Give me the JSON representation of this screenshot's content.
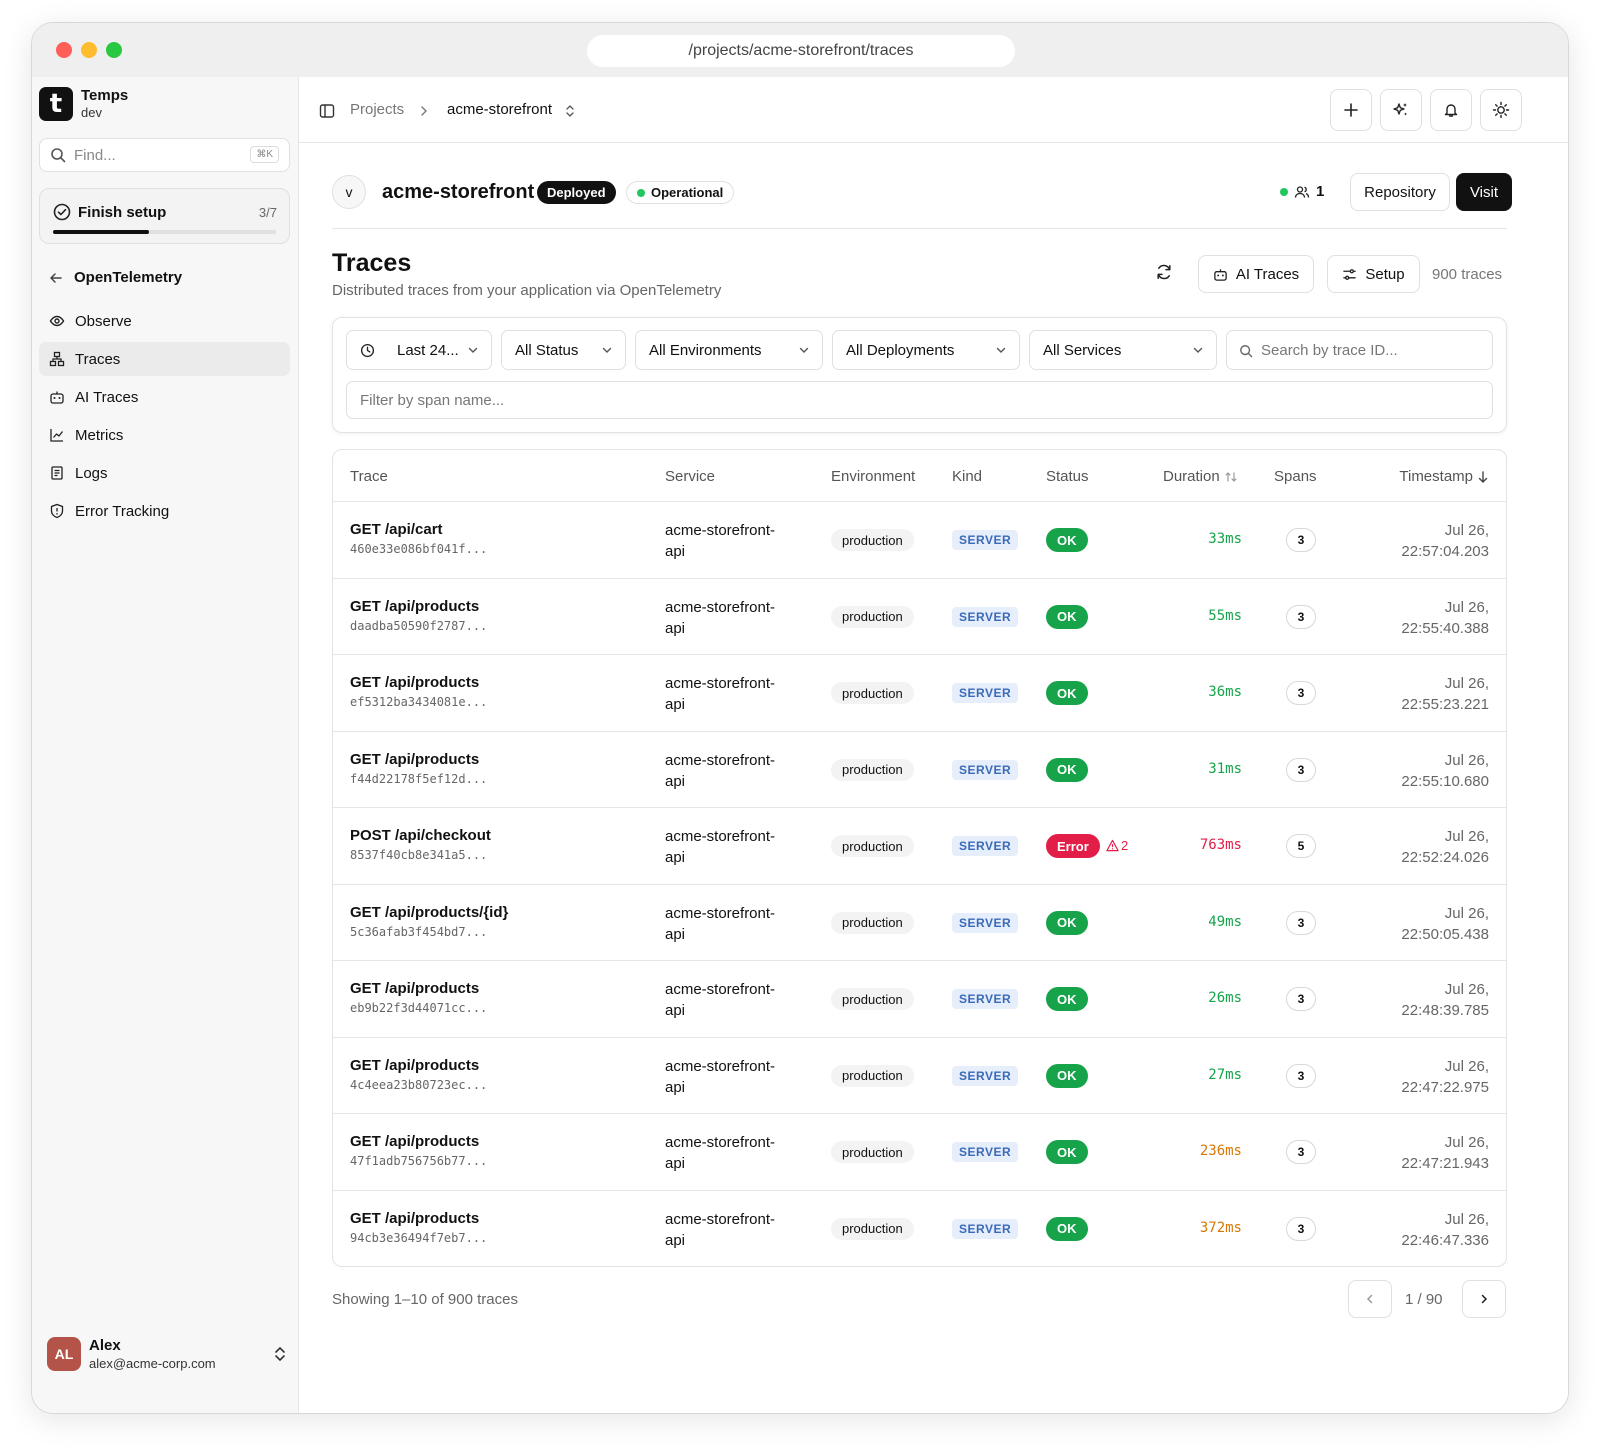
{
  "browser": {
    "url": "/projects/acme-storefront/traces"
  },
  "sidebar": {
    "brand_name": "Temps",
    "brand_env": "dev",
    "logo_letter": "t",
    "find_placeholder": "Find...",
    "find_shortcut": "⌘K",
    "setup_label": "Finish setup",
    "setup_count": "3/7",
    "setup_progress": 0.43,
    "back_label": "OpenTelemetry",
    "items": [
      {
        "label": "Observe",
        "icon": "eye-icon"
      },
      {
        "label": "Traces",
        "icon": "tree-icon",
        "active": true
      },
      {
        "label": "AI Traces",
        "icon": "robot-icon"
      },
      {
        "label": "Metrics",
        "icon": "chart-line-icon"
      },
      {
        "label": "Logs",
        "icon": "scroll-icon"
      },
      {
        "label": "Error Tracking",
        "icon": "shield-alert-icon"
      }
    ],
    "user": {
      "initials": "AL",
      "name": "Alex",
      "email": "alex@acme-corp.com"
    }
  },
  "topbar": {
    "crumb_projects": "Projects",
    "crumb_project": "acme-storefront"
  },
  "project": {
    "avatar": "v",
    "name": "acme-storefront",
    "deployed_label": "Deployed",
    "status_label": "Operational",
    "members_count": "1",
    "repo_label": "Repository",
    "visit_label": "Visit"
  },
  "page": {
    "title": "Traces",
    "subtitle": "Distributed traces from your application via OpenTelemetry",
    "ai_traces_label": "AI Traces",
    "setup_label": "Setup",
    "count_label": "900 traces"
  },
  "filters": {
    "time": "Last 24...",
    "status": "All Status",
    "environments": "All Environments",
    "deployments": "All Deployments",
    "services": "All Services",
    "search_placeholder": "Search by trace ID...",
    "span_placeholder": "Filter by span name..."
  },
  "table": {
    "headers": {
      "trace": "Trace",
      "service": "Service",
      "environment": "Environment",
      "kind": "Kind",
      "status": "Status",
      "duration": "Duration",
      "spans": "Spans",
      "timestamp": "Timestamp"
    },
    "rows": [
      {
        "name": "GET /api/cart",
        "id": "460e33e086bf041f...",
        "service1": "acme-storefront-",
        "service2": "api",
        "env": "production",
        "kind": "SERVER",
        "status": "OK",
        "status_type": "ok",
        "duration": "33ms",
        "dur_color": "#16a34a",
        "spans": "3",
        "date": "Jul 26,",
        "time": "22:57:04.203"
      },
      {
        "name": "GET /api/products",
        "id": "daadba50590f2787...",
        "service1": "acme-storefront-",
        "service2": "api",
        "env": "production",
        "kind": "SERVER",
        "status": "OK",
        "status_type": "ok",
        "duration": "55ms",
        "dur_color": "#16a34a",
        "spans": "3",
        "date": "Jul 26,",
        "time": "22:55:40.388"
      },
      {
        "name": "GET /api/products",
        "id": "ef5312ba3434081e...",
        "service1": "acme-storefront-",
        "service2": "api",
        "env": "production",
        "kind": "SERVER",
        "status": "OK",
        "status_type": "ok",
        "duration": "36ms",
        "dur_color": "#16a34a",
        "spans": "3",
        "date": "Jul 26,",
        "time": "22:55:23.221"
      },
      {
        "name": "GET /api/products",
        "id": "f44d22178f5ef12d...",
        "service1": "acme-storefront-",
        "service2": "api",
        "env": "production",
        "kind": "SERVER",
        "status": "OK",
        "status_type": "ok",
        "duration": "31ms",
        "dur_color": "#16a34a",
        "spans": "3",
        "date": "Jul 26,",
        "time": "22:55:10.680"
      },
      {
        "name": "POST /api/checkout",
        "id": "8537f40cb8e341a5...",
        "service1": "acme-storefront-",
        "service2": "api",
        "env": "production",
        "kind": "SERVER",
        "status": "Error",
        "status_type": "err",
        "warn_count": "2",
        "duration": "763ms",
        "dur_color": "#e11d48",
        "spans": "5",
        "date": "Jul 26,",
        "time": "22:52:24.026"
      },
      {
        "name": "GET /api/products/{id}",
        "id": "5c36afab3f454bd7...",
        "service1": "acme-storefront-",
        "service2": "api",
        "env": "production",
        "kind": "SERVER",
        "status": "OK",
        "status_type": "ok",
        "duration": "49ms",
        "dur_color": "#16a34a",
        "spans": "3",
        "date": "Jul 26,",
        "time": "22:50:05.438"
      },
      {
        "name": "GET /api/products",
        "id": "eb9b22f3d44071cc...",
        "service1": "acme-storefront-",
        "service2": "api",
        "env": "production",
        "kind": "SERVER",
        "status": "OK",
        "status_type": "ok",
        "duration": "26ms",
        "dur_color": "#16a34a",
        "spans": "3",
        "date": "Jul 26,",
        "time": "22:48:39.785"
      },
      {
        "name": "GET /api/products",
        "id": "4c4eea23b80723ec...",
        "service1": "acme-storefront-",
        "service2": "api",
        "env": "production",
        "kind": "SERVER",
        "status": "OK",
        "status_type": "ok",
        "duration": "27ms",
        "dur_color": "#16a34a",
        "spans": "3",
        "date": "Jul 26,",
        "time": "22:47:22.975"
      },
      {
        "name": "GET /api/products",
        "id": "47f1adb756756b77...",
        "service1": "acme-storefront-",
        "service2": "api",
        "env": "production",
        "kind": "SERVER",
        "status": "OK",
        "status_type": "ok",
        "duration": "236ms",
        "dur_color": "#d97706",
        "spans": "3",
        "date": "Jul 26,",
        "time": "22:47:21.943"
      },
      {
        "name": "GET /api/products",
        "id": "94cb3e36494f7eb7...",
        "service1": "acme-storefront-",
        "service2": "api",
        "env": "production",
        "kind": "SERVER",
        "status": "OK",
        "status_type": "ok",
        "duration": "372ms",
        "dur_color": "#d97706",
        "spans": "3",
        "date": "Jul 26,",
        "time": "22:46:47.336"
      }
    ]
  },
  "pagination": {
    "showing": "Showing 1–10 of 900 traces",
    "page": "1 / 90"
  }
}
